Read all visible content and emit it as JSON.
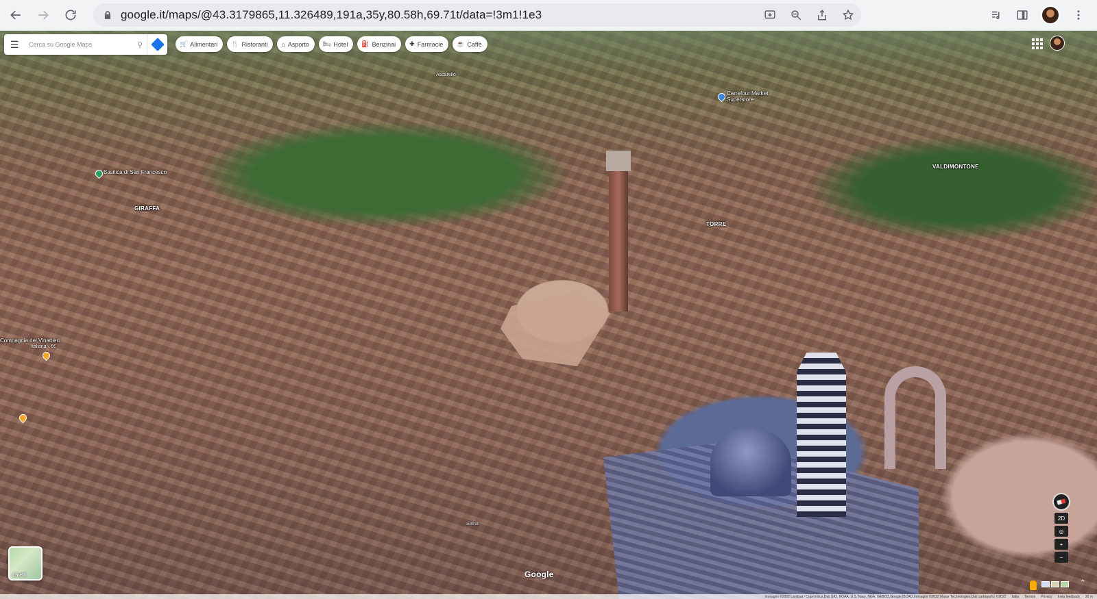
{
  "browser": {
    "url": "google.it/maps/@43.3179865,11.326489,191a,35y,80.58h,69.71t/data=!3m1!1e3",
    "nav_icons": [
      "back-arrow-icon",
      "forward-arrow-icon",
      "reload-icon"
    ],
    "omnibox_icons": [
      "install-icon",
      "zoom-icon",
      "share-icon",
      "bookmark-star-icon"
    ],
    "toolbar_icons": [
      "media-icon",
      "side-panel-icon",
      "profile-avatar",
      "more-vert-icon"
    ]
  },
  "search": {
    "placeholder": "Cerca su Google Maps"
  },
  "chips": [
    {
      "label": "Alimentari",
      "icon": "cart-icon",
      "glyph": "🛒"
    },
    {
      "label": "Ristoranti",
      "icon": "fork-knife-icon",
      "glyph": "🍴"
    },
    {
      "label": "Asporto",
      "icon": "takeout-icon",
      "glyph": "⌂"
    },
    {
      "label": "Hotel",
      "icon": "bed-icon",
      "glyph": "🛏"
    },
    {
      "label": "Benzinai",
      "icon": "gas-station-icon",
      "glyph": "⛽"
    },
    {
      "label": "Farmacie",
      "icon": "pharmacy-icon",
      "glyph": "✚"
    },
    {
      "label": "Caffè",
      "icon": "coffee-icon",
      "glyph": "☕"
    }
  ],
  "map": {
    "places": {
      "ascarello": "Ascarello",
      "carrefour": "Carrefour Market\nSuperstore",
      "basilica": "Basilica di San Francesco",
      "vinattieri": "Compagnia dei Vinattieri",
      "vinattieri_sub": "Italiana · €€",
      "siena": "Siena"
    },
    "districts": {
      "giraffa": "GIRAFFA",
      "torre": "TORRE",
      "valdimontone": "VALDIMONTONE"
    },
    "layers_label": "Livelli",
    "google_logo": "Google",
    "controls": {
      "toggle_2d": "2D",
      "zoom_in": "+",
      "zoom_out": "−"
    },
    "footer": {
      "attribution": "Immagini ©2022 Landsat / Copernicus,Dati SIO, NOAA, U.S. Navy, NGA, GEBCO,Google,IBCAO,Immagini ©2022 Maxar Technologies,Dati cartografici ©2022",
      "country": "Italia",
      "terms": "Termini",
      "privacy": "Privacy",
      "feedback": "Invia feedback",
      "scale": "20 m"
    }
  }
}
